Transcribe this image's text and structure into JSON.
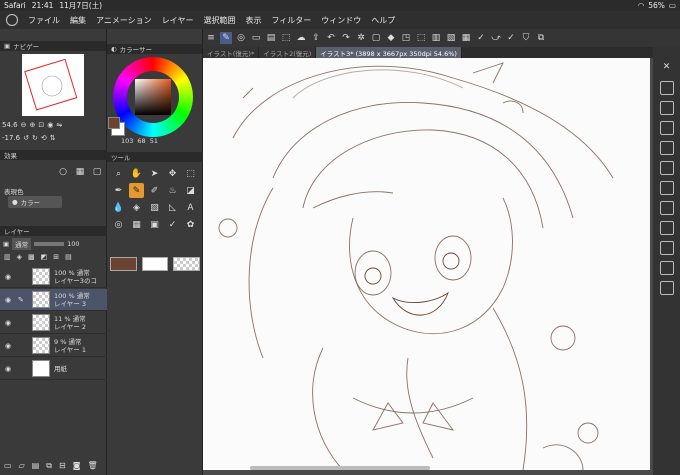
{
  "status": {
    "app": "Safari",
    "time": "21:41",
    "date": "11月7日(土)",
    "battery": "56%"
  },
  "menu": [
    "ファイル",
    "編集",
    "アニメーション",
    "レイヤー",
    "選択範囲",
    "表示",
    "フィルター",
    "ウィンドウ",
    "ヘルプ"
  ],
  "navigator": {
    "title": "ナビゲー",
    "zoom": "54.6",
    "rotate": "-17.6"
  },
  "colorpanel": {
    "title": "カラーサー",
    "values": [
      "103",
      "68",
      "51"
    ]
  },
  "tools": {
    "title": "ツール"
  },
  "effect": {
    "title": "効果"
  },
  "expression": {
    "title": "表現色",
    "value": "カラー"
  },
  "layerpanel": {
    "title": "レイヤー",
    "blend": "通常",
    "opacity": "100"
  },
  "layers": [
    {
      "mode": "100 % 通常",
      "name": "レイヤー3のコ",
      "paper": false,
      "selected": false
    },
    {
      "mode": "100 % 通常",
      "name": "レイヤー 3",
      "paper": false,
      "selected": true
    },
    {
      "mode": "11 % 通常",
      "name": "レイヤー 2",
      "paper": false,
      "selected": false
    },
    {
      "mode": "9 % 通常",
      "name": "レイヤー 1",
      "paper": false,
      "selected": false
    },
    {
      "mode": "",
      "name": "用紙",
      "paper": true,
      "selected": false
    }
  ],
  "tabs": [
    "イラスト(復元)*",
    "イラスト2(復元)",
    "イラスト3* (3898 x 3667px 350dpi 54.6%)"
  ],
  "colors": {
    "main": "#6b4332",
    "sub": "#ffffff",
    "accent": "#e59a2f"
  }
}
